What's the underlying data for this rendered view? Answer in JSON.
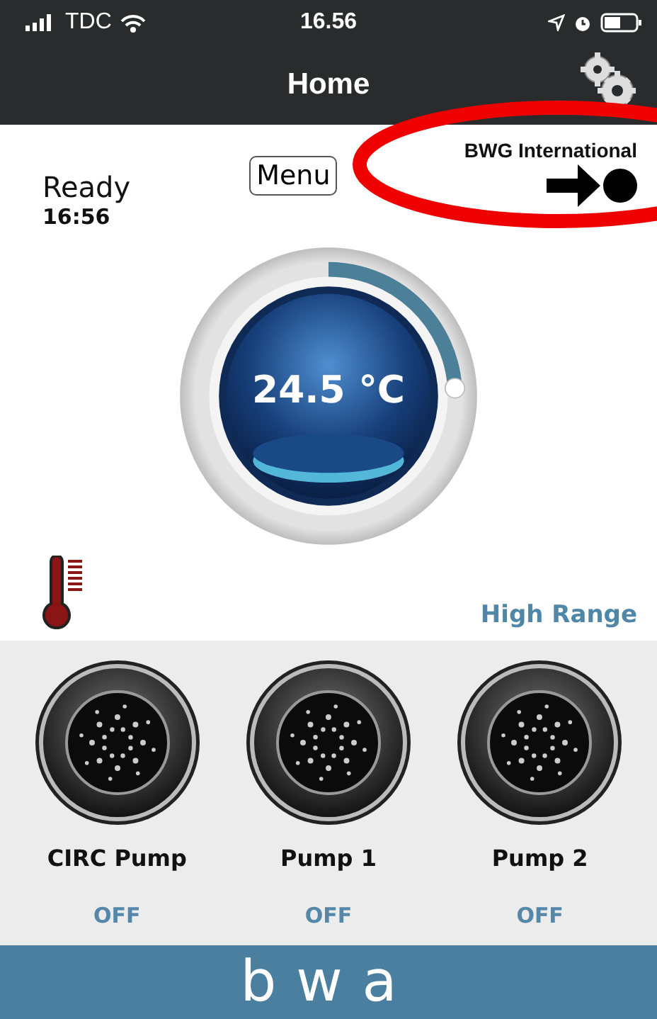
{
  "status_bar": {
    "carrier": "TDC",
    "time": "16.56"
  },
  "header": {
    "title": "Home"
  },
  "info": {
    "status": "Ready",
    "time": "16:56",
    "menu_button": "Menu",
    "location": "BWG International"
  },
  "gauge": {
    "temperature": "24.5 °C",
    "level": 0.24
  },
  "range": "High Range",
  "pumps": [
    {
      "name": "CIRC Pump",
      "state": "OFF",
      "on": false
    },
    {
      "name": "Pump 1",
      "state": "OFF",
      "on": false
    },
    {
      "name": "Pump 2",
      "state": "OFF",
      "on": false
    }
  ],
  "footer": {
    "logo": "bwa"
  }
}
